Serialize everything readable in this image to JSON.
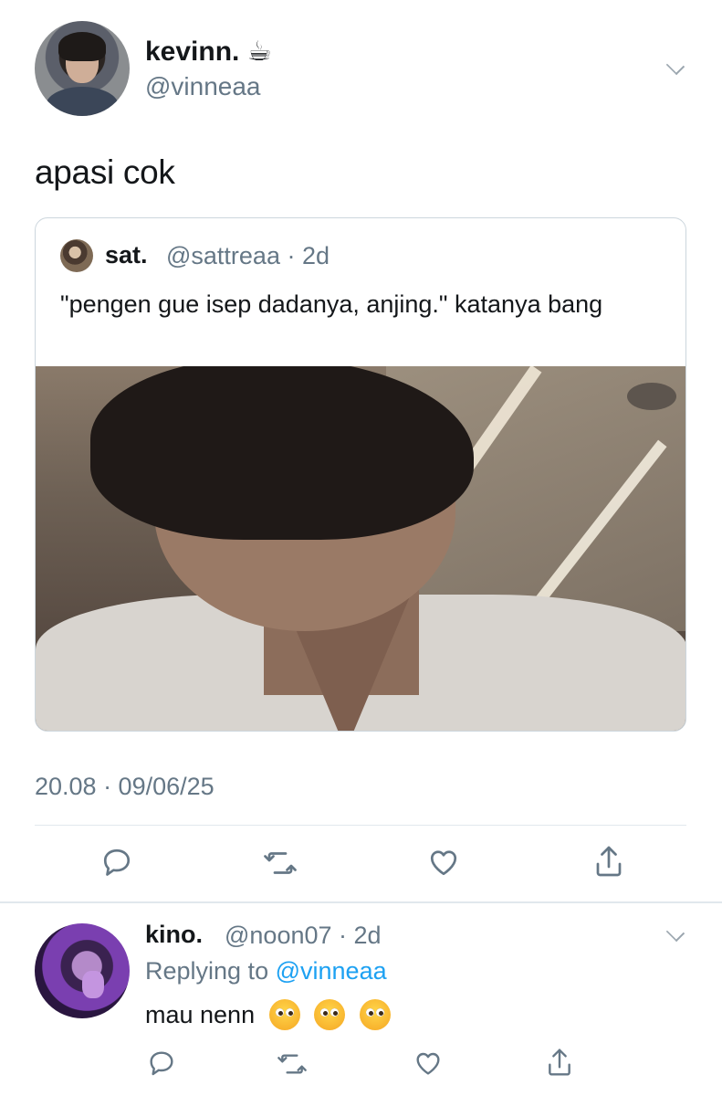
{
  "main_tweet": {
    "display_name": "kevinn.",
    "name_emoji": "☕",
    "handle": "@vinneaa",
    "text": "apasi cok",
    "timestamp": "20.08 · 09/06/25"
  },
  "quoted_tweet": {
    "display_name": "sat.",
    "handle_time": "@sattreaa · 2d",
    "text": "\"pengen gue isep dadanya, anjing.\" katanya bang"
  },
  "actions": {
    "reply_icon": "reply-icon",
    "retweet_icon": "retweet-icon",
    "like_icon": "heart-icon",
    "share_icon": "share-icon"
  },
  "reply": {
    "display_name": "kino.",
    "handle_time": "@noon07 · 2d",
    "replying_prefix": "Replying to",
    "replying_mention": "@vinneaa",
    "text": "mau nenn",
    "emoji": "🥺"
  },
  "colors": {
    "accent": "#1da1f2",
    "muted": "#657786",
    "border": "#e1e8ed"
  }
}
